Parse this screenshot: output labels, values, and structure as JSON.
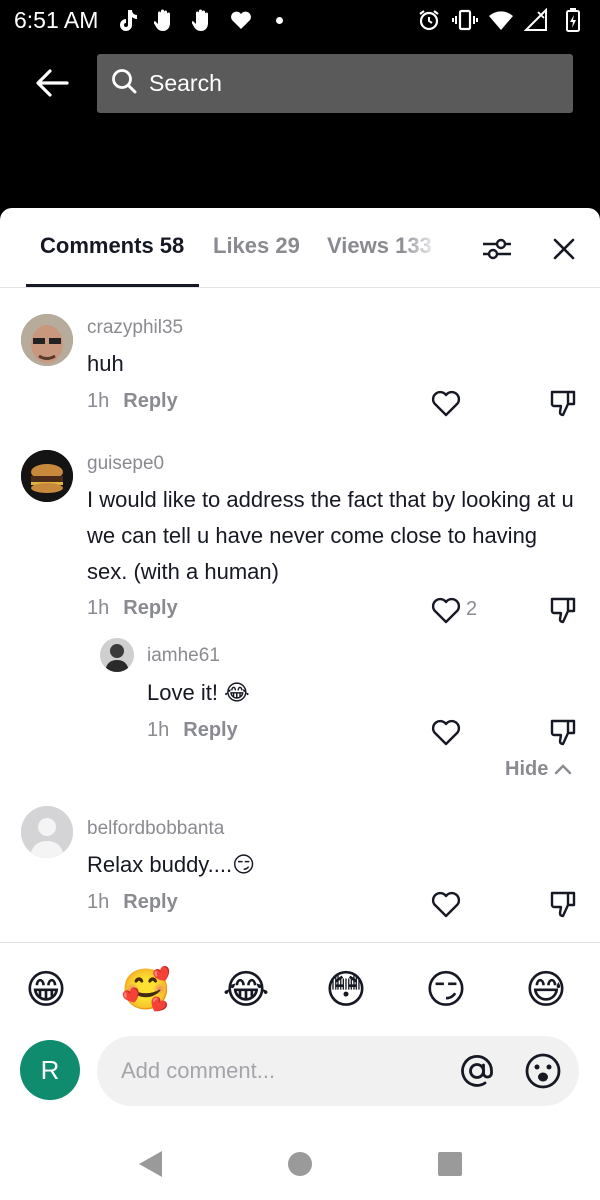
{
  "status_bar": {
    "time": "6:51 AM",
    "left_icons": [
      "tiktok-icon",
      "hand-icon",
      "hand-icon",
      "heart-icon",
      "dot-icon"
    ],
    "right_icons": [
      "alarm-icon",
      "vibrate-icon",
      "wifi-icon",
      "signal-icon",
      "battery-icon"
    ]
  },
  "search": {
    "placeholder": "Search"
  },
  "tabs": [
    {
      "label": "Comments 58",
      "active": true
    },
    {
      "label": "Likes 29",
      "active": false
    },
    {
      "label": "Views 133",
      "active": false
    }
  ],
  "comments": [
    {
      "username": "crazyphil35",
      "text": "huh",
      "time": "1h",
      "reply_label": "Reply",
      "likes": ""
    },
    {
      "username": "guisepe0",
      "text": "I would like to address the fact that by looking at u we can tell u have never come close to having sex. (with a human)",
      "time": "1h",
      "reply_label": "Reply",
      "likes": "2"
    },
    {
      "username": "iamhe61",
      "text": "Love it! 😂",
      "time": "1h",
      "reply_label": "Reply",
      "likes": ""
    },
    {
      "username": "belfordbobbanta",
      "text": "Relax buddy....😏",
      "time": "1h",
      "reply_label": "Reply",
      "likes": ""
    }
  ],
  "hide_label": "Hide",
  "quick_emojis": [
    "😁",
    "🥰",
    "😂",
    "😳",
    "😏",
    "😅"
  ],
  "composer": {
    "avatar_letter": "R",
    "placeholder": "Add comment...",
    "avatar_color": "#0e8c6d"
  },
  "colors": {
    "accent_text": "#161823",
    "muted_text": "#8a8b91",
    "background": "#000000"
  }
}
